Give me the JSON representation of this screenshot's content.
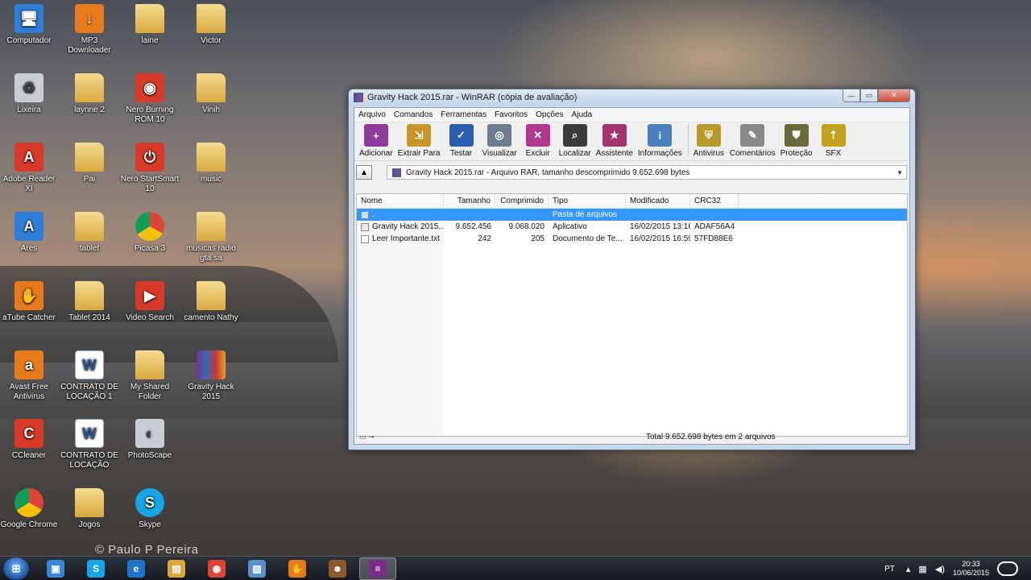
{
  "desktop": {
    "icons": [
      {
        "label": "Computador",
        "glyph": "🖥",
        "style": "blue",
        "icon": "computer-icon"
      },
      {
        "label": "MP3 Downloader",
        "glyph": "↓",
        "style": "orange",
        "icon": "mp3-downloader-icon"
      },
      {
        "label": "laine",
        "glyph": "",
        "style": "folder",
        "icon": "folder-icon"
      },
      {
        "label": "Victor",
        "glyph": "",
        "style": "folder",
        "icon": "folder-icon"
      },
      {
        "label": "Lixeira",
        "glyph": "♻",
        "style": "gray",
        "icon": "recycle-bin-icon"
      },
      {
        "label": "laynne 2",
        "glyph": "",
        "style": "folder",
        "icon": "folder-icon"
      },
      {
        "label": "Nero Burning ROM 10",
        "glyph": "◉",
        "style": "app",
        "icon": "nero-burning-rom-icon"
      },
      {
        "label": "Vinih",
        "glyph": "",
        "style": "folder",
        "icon": "folder-icon"
      },
      {
        "label": "Adobe Reader XI",
        "glyph": "A",
        "style": "app",
        "icon": "adobe-reader-icon"
      },
      {
        "label": "Pai",
        "glyph": "",
        "style": "folder",
        "icon": "folder-icon"
      },
      {
        "label": "Nero StartSmart 10",
        "glyph": "⏻",
        "style": "app",
        "icon": "nero-startsmart-icon"
      },
      {
        "label": "music",
        "glyph": "",
        "style": "folder",
        "icon": "folder-icon"
      },
      {
        "label": "Ares",
        "glyph": "A",
        "style": "blue",
        "icon": "ares-icon"
      },
      {
        "label": "tablet",
        "glyph": "",
        "style": "folder",
        "icon": "folder-icon"
      },
      {
        "label": "Picasa 3",
        "glyph": "",
        "style": "chrome",
        "icon": "picasa-icon"
      },
      {
        "label": "musicas radio gta sa",
        "glyph": "",
        "style": "folder",
        "icon": "folder-icon"
      },
      {
        "label": "aTube Catcher",
        "glyph": "✋",
        "style": "orange",
        "icon": "atube-catcher-icon"
      },
      {
        "label": "Tablet 2014",
        "glyph": "",
        "style": "folder",
        "icon": "folder-icon"
      },
      {
        "label": "Video Search",
        "glyph": "▶",
        "style": "app",
        "icon": "video-search-icon"
      },
      {
        "label": "camento Nathy",
        "glyph": "",
        "style": "folder",
        "icon": "folder-icon"
      },
      {
        "label": "Avast Free Antivirus",
        "glyph": "a",
        "style": "orange",
        "icon": "avast-icon"
      },
      {
        "label": "CONTRATO DE LOCAÇÃO 1",
        "glyph": "W",
        "style": "doc",
        "icon": "word-document-icon"
      },
      {
        "label": "My Shared Folder",
        "glyph": "",
        "style": "folder",
        "icon": "folder-icon"
      },
      {
        "label": "Gravity Hack 2015",
        "glyph": "",
        "style": "rar",
        "icon": "winrar-archive-icon"
      },
      {
        "label": "CCleaner",
        "glyph": "C",
        "style": "app",
        "icon": "ccleaner-icon"
      },
      {
        "label": "CONTRATO DE LOCAÇÃO",
        "glyph": "W",
        "style": "doc",
        "icon": "word-document-icon"
      },
      {
        "label": "PhotoScape",
        "glyph": "◐",
        "style": "gray",
        "icon": "photoscape-icon"
      },
      {
        "label": "Google Chrome",
        "glyph": "",
        "style": "chrome",
        "icon": "chrome-icon"
      },
      {
        "label": "Jogos",
        "glyph": "",
        "style": "folder",
        "icon": "folder-icon"
      },
      {
        "label": "Skype",
        "glyph": "S",
        "style": "skype",
        "icon": "skype-icon"
      }
    ],
    "watermark": "©  Paulo P Pereira"
  },
  "window": {
    "title": "Gravity Hack 2015.rar - WinRAR (cópia de avaliação)",
    "controls": {
      "minimize": "—",
      "maximize": "▭",
      "close": "✕"
    },
    "menu": [
      "Arquivo",
      "Comandos",
      "Ferramentas",
      "Favoritos",
      "Opções",
      "Ajuda"
    ],
    "toolbar": [
      {
        "label": "Adicionar",
        "glyph": "+",
        "color": "#8e3a9c",
        "icon": "add-icon"
      },
      {
        "label": "Extrair Para",
        "glyph": "⇲",
        "color": "#c8952a",
        "icon": "extract-icon"
      },
      {
        "label": "Testar",
        "glyph": "✓",
        "color": "#2a5fb0",
        "icon": "test-icon"
      },
      {
        "label": "Visualizar",
        "glyph": "◎",
        "color": "#6d7d8e",
        "icon": "view-icon"
      },
      {
        "label": "Excluir",
        "glyph": "✕",
        "color": "#b23a8e",
        "icon": "delete-icon"
      },
      {
        "label": "Localizar",
        "glyph": "⌕",
        "color": "#3b3b3b",
        "icon": "find-icon"
      },
      {
        "label": "Assistente",
        "glyph": "★",
        "color": "#a3346e",
        "icon": "wizard-icon"
      },
      {
        "label": "Informações",
        "glyph": "i",
        "color": "#4a7fc0",
        "icon": "info-icon"
      },
      {
        "label": "Antivirus",
        "glyph": "⛨",
        "color": "#b89a2a",
        "icon": "antivirus-icon"
      },
      {
        "label": "Comentários",
        "glyph": "✎",
        "color": "#8a8a8a",
        "icon": "comment-icon"
      },
      {
        "label": "Proteção",
        "glyph": "⛊",
        "color": "#6a6a3a",
        "icon": "protect-icon"
      },
      {
        "label": "SFX",
        "glyph": "⇡",
        "color": "#c2a21f",
        "icon": "sfx-icon"
      }
    ],
    "path": "Gravity Hack 2015.rar - Arquivo RAR, tamanho descomprimido 9.652.698 bytes",
    "columns": {
      "name": "Nome",
      "size": "Tamanho",
      "packed": "Comprimido",
      "type": "Tipo",
      "modified": "Modificado",
      "crc": "CRC32"
    },
    "files": [
      {
        "name": "..",
        "size": "",
        "packed": "",
        "type": "Pasta de arquivos",
        "modified": "",
        "crc": "",
        "selected": true,
        "kind": "up"
      },
      {
        "name": "Gravity Hack 2015....",
        "size": "9.652.456",
        "packed": "9.068.020",
        "type": "Aplicativo",
        "modified": "16/02/2015 13:16",
        "crc": "ADAF56A4",
        "selected": false,
        "kind": "exe"
      },
      {
        "name": "Leer Importante.txt",
        "size": "242",
        "packed": "205",
        "type": "Documento de Te...",
        "modified": "16/02/2015 16:59",
        "crc": "57FD88E6",
        "selected": false,
        "kind": "txt"
      }
    ],
    "status": "Total 9.652.698 bytes em 2 arquivos"
  },
  "taskbar": {
    "apps": [
      {
        "icon": "windows-explorer-icon",
        "glyph": "▣",
        "color": "#3a86d6"
      },
      {
        "icon": "skype-taskbar-icon",
        "glyph": "S",
        "color": "#16a5e8"
      },
      {
        "icon": "internet-explorer-icon",
        "glyph": "e",
        "color": "#1f74c9"
      },
      {
        "icon": "file-explorer-icon",
        "glyph": "▤",
        "color": "#d9a93e"
      },
      {
        "icon": "chrome-taskbar-icon",
        "glyph": "◉",
        "color": "#db4437"
      },
      {
        "icon": "picture-viewer-icon",
        "glyph": "▨",
        "color": "#5a8fc8"
      },
      {
        "icon": "atube-taskbar-icon",
        "glyph": "✋",
        "color": "#e77a1a"
      },
      {
        "icon": "character-app-icon",
        "glyph": "☻",
        "color": "#8b5a2b"
      },
      {
        "icon": "winrar-taskbar-icon",
        "glyph": "≡",
        "color": "#7b2d8e"
      }
    ],
    "language": "PT",
    "time": "20:33",
    "date": "10/06/2015"
  }
}
